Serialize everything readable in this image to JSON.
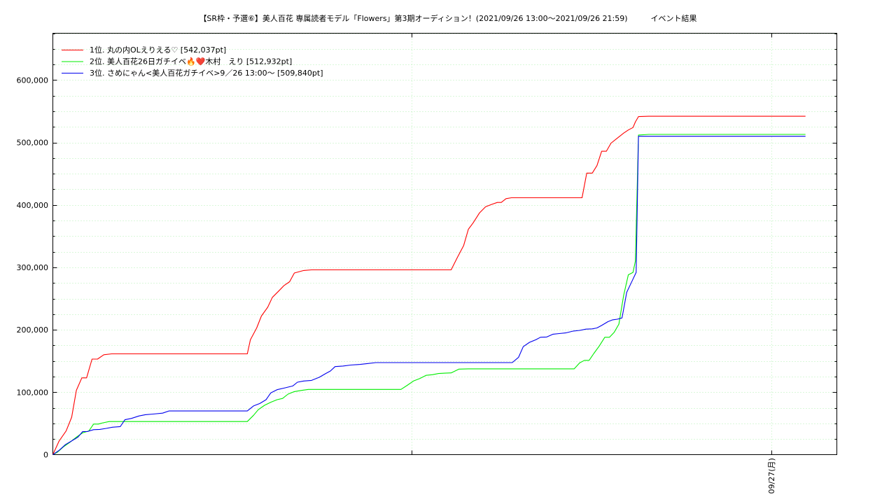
{
  "chart_data": {
    "type": "line",
    "title": "【SR枠・予選⑥】美人百花 専属読者モデル「Flowers」第3期オーディション！(2021/09/26 13:00〜2021/09/26 21:59)　　　イベント結果",
    "xlabel": "",
    "ylabel": "",
    "x_tick_labels": [
      "09/27(月)"
    ],
    "y_ticks": [
      0,
      100000,
      200000,
      300000,
      400000,
      500000,
      600000
    ],
    "y_tick_labels": [
      "0",
      "100,000",
      "200,000",
      "300,000",
      "400,000",
      "500,000",
      "600,000"
    ],
    "ylim": [
      0,
      675000
    ],
    "xlim": [
      0,
      1000
    ],
    "grid": true,
    "legend_position": "top-left",
    "series": [
      {
        "name": "1位. 丸の内OLえりえる♡ [542,037pt]",
        "color": "#ff0000",
        "points": [
          [
            0,
            0
          ],
          [
            8,
            22000
          ],
          [
            17,
            38000
          ],
          [
            24,
            60000
          ],
          [
            30,
            103000
          ],
          [
            37,
            123000
          ],
          [
            43,
            123000
          ],
          [
            50,
            153000
          ],
          [
            57,
            153000
          ],
          [
            65,
            160000
          ],
          [
            75,
            161500
          ],
          [
            100,
            161500
          ],
          [
            200,
            161500
          ],
          [
            248,
            161500
          ],
          [
            252,
            184000
          ],
          [
            260,
            203000
          ],
          [
            266,
            222000
          ],
          [
            274,
            236000
          ],
          [
            280,
            252000
          ],
          [
            288,
            262000
          ],
          [
            295,
            271000
          ],
          [
            302,
            277000
          ],
          [
            308,
            291000
          ],
          [
            320,
            295000
          ],
          [
            330,
            296000
          ],
          [
            400,
            296000
          ],
          [
            500,
            296000
          ],
          [
            508,
            296000
          ],
          [
            516,
            316000
          ],
          [
            524,
            335000
          ],
          [
            530,
            361000
          ],
          [
            536,
            371000
          ],
          [
            544,
            387000
          ],
          [
            552,
            397000
          ],
          [
            560,
            401000
          ],
          [
            567,
            404000
          ],
          [
            572,
            404000
          ],
          [
            578,
            410000
          ],
          [
            585,
            411500
          ],
          [
            600,
            411500
          ],
          [
            650,
            411500
          ],
          [
            675,
            411500
          ],
          [
            681,
            451000
          ],
          [
            688,
            451000
          ],
          [
            694,
            463000
          ],
          [
            700,
            486000
          ],
          [
            706,
            486000
          ],
          [
            712,
            499000
          ],
          [
            720,
            507000
          ],
          [
            728,
            515000
          ],
          [
            734,
            520000
          ],
          [
            740,
            524000
          ],
          [
            743,
            533000
          ],
          [
            747,
            541500
          ],
          [
            760,
            542000
          ],
          [
            900,
            542000
          ],
          [
            960,
            542000
          ]
        ]
      },
      {
        "name": "2位. 美人百花26日ガチイベ🔥❤️木村　えり [512,932pt]",
        "color": "#00ee00",
        "points": [
          [
            0,
            0
          ],
          [
            6,
            4000
          ],
          [
            14,
            13000
          ],
          [
            22,
            20000
          ],
          [
            30,
            28000
          ],
          [
            38,
            35000
          ],
          [
            46,
            38000
          ],
          [
            52,
            49000
          ],
          [
            58,
            49000
          ],
          [
            64,
            51000
          ],
          [
            72,
            53000
          ],
          [
            90,
            53000
          ],
          [
            150,
            53000
          ],
          [
            200,
            53000
          ],
          [
            248,
            53000
          ],
          [
            256,
            63000
          ],
          [
            262,
            72000
          ],
          [
            270,
            79000
          ],
          [
            278,
            84000
          ],
          [
            286,
            88000
          ],
          [
            293,
            90000
          ],
          [
            300,
            97000
          ],
          [
            308,
            101000
          ],
          [
            318,
            103000
          ],
          [
            326,
            104500
          ],
          [
            400,
            104500
          ],
          [
            444,
            104500
          ],
          [
            452,
            111000
          ],
          [
            460,
            118000
          ],
          [
            468,
            122000
          ],
          [
            476,
            127000
          ],
          [
            484,
            128000
          ],
          [
            492,
            130000
          ],
          [
            500,
            130500
          ],
          [
            508,
            131000
          ],
          [
            518,
            137000
          ],
          [
            530,
            137500
          ],
          [
            600,
            137500
          ],
          [
            665,
            137500
          ],
          [
            672,
            147000
          ],
          [
            678,
            151000
          ],
          [
            684,
            151000
          ],
          [
            690,
            162000
          ],
          [
            697,
            174000
          ],
          [
            704,
            188000
          ],
          [
            710,
            188000
          ],
          [
            716,
            196000
          ],
          [
            722,
            209000
          ],
          [
            728,
            255000
          ],
          [
            734,
            288000
          ],
          [
            740,
            292000
          ],
          [
            743,
            310000
          ],
          [
            747,
            512000
          ],
          [
            760,
            513000
          ],
          [
            960,
            513000
          ]
        ]
      },
      {
        "name": "3位. さめにゃん<美人百花ガチイベ>9／26 13:00〜 [509,840pt]",
        "color": "#0000ee",
        "points": [
          [
            0,
            0
          ],
          [
            8,
            7000
          ],
          [
            16,
            16000
          ],
          [
            24,
            22000
          ],
          [
            32,
            28000
          ],
          [
            38,
            37000
          ],
          [
            44,
            37000
          ],
          [
            52,
            40000
          ],
          [
            60,
            40500
          ],
          [
            68,
            42000
          ],
          [
            76,
            44000
          ],
          [
            86,
            45000
          ],
          [
            92,
            56000
          ],
          [
            100,
            58000
          ],
          [
            110,
            62000
          ],
          [
            118,
            64000
          ],
          [
            128,
            65000
          ],
          [
            140,
            66500
          ],
          [
            148,
            70000
          ],
          [
            160,
            70000
          ],
          [
            200,
            70000
          ],
          [
            248,
            70000
          ],
          [
            256,
            78000
          ],
          [
            264,
            82000
          ],
          [
            272,
            88000
          ],
          [
            278,
            99000
          ],
          [
            286,
            104000
          ],
          [
            296,
            107000
          ],
          [
            306,
            110000
          ],
          [
            312,
            116000
          ],
          [
            320,
            118000
          ],
          [
            330,
            119000
          ],
          [
            340,
            124000
          ],
          [
            348,
            130000
          ],
          [
            354,
            134000
          ],
          [
            360,
            141000
          ],
          [
            370,
            142000
          ],
          [
            380,
            143500
          ],
          [
            392,
            144500
          ],
          [
            402,
            146000
          ],
          [
            412,
            147500
          ],
          [
            460,
            147500
          ],
          [
            500,
            147500
          ],
          [
            586,
            147500
          ],
          [
            594,
            156000
          ],
          [
            600,
            173000
          ],
          [
            608,
            180000
          ],
          [
            616,
            184000
          ],
          [
            622,
            188000
          ],
          [
            630,
            188500
          ],
          [
            638,
            193000
          ],
          [
            646,
            194000
          ],
          [
            654,
            195000
          ],
          [
            664,
            198000
          ],
          [
            672,
            199000
          ],
          [
            680,
            201000
          ],
          [
            688,
            201500
          ],
          [
            694,
            203000
          ],
          [
            700,
            207000
          ],
          [
            708,
            213000
          ],
          [
            714,
            216000
          ],
          [
            720,
            217000
          ],
          [
            726,
            219000
          ],
          [
            732,
            260000
          ],
          [
            738,
            276000
          ],
          [
            744,
            292000
          ],
          [
            747,
            510000
          ],
          [
            760,
            510000
          ],
          [
            960,
            510000
          ]
        ]
      }
    ]
  }
}
